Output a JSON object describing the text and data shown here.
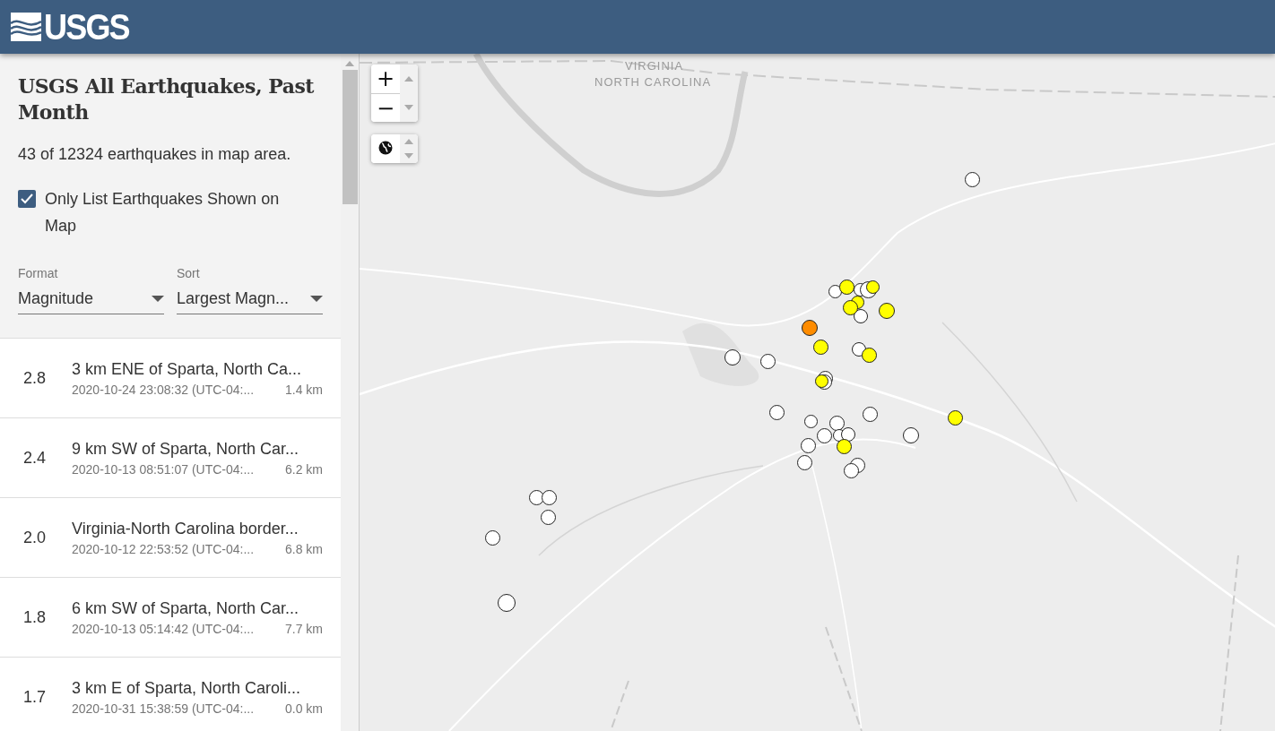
{
  "header": {
    "logo": "USGS"
  },
  "sidebar": {
    "title": "USGS All Earthquakes, Past Month",
    "count": "43 of 12324 earthquakes in map area.",
    "filter": {
      "label": "Only List Earthquakes Shown on Map",
      "checked": true
    },
    "selects": [
      {
        "label": "Format",
        "value": "Magnitude"
      },
      {
        "label": "Sort",
        "value": "Largest Magn..."
      }
    ],
    "events": [
      {
        "magnitude": "2.8",
        "place": "3 km ENE of Sparta, North Ca...",
        "time": "2020-10-24 23:08:32 (UTC-04:...",
        "depth": "1.4 km"
      },
      {
        "magnitude": "2.4",
        "place": "9 km SW of Sparta, North Car...",
        "time": "2020-10-13 08:51:07 (UTC-04:...",
        "depth": "6.2 km"
      },
      {
        "magnitude": "2.0",
        "place": "Virginia-North Carolina border...",
        "time": "2020-10-12 22:53:52 (UTC-04:...",
        "depth": "6.8 km"
      },
      {
        "magnitude": "1.8",
        "place": "6 km SW of Sparta, North Car...",
        "time": "2020-10-13 05:14:42 (UTC-04:...",
        "depth": "7.7 km"
      },
      {
        "magnitude": "1.7",
        "place": "3 km E of Sparta, North Caroli...",
        "time": "2020-10-31 15:38:59 (UTC-04:...",
        "depth": "0.0 km"
      }
    ]
  },
  "map": {
    "labels": [
      "VIRGINIA",
      "NORTH CAROLINA"
    ],
    "zoom_in": "+",
    "zoom_out": "−",
    "markers": [
      {
        "color": "#ffffff"
      },
      {
        "color": "#ffffff"
      },
      {
        "color": "#ffffff"
      },
      {
        "color": "#ffffff"
      },
      {
        "color": "#ffffff"
      },
      {
        "color": "#ffffff"
      },
      {
        "color": "#ffffff"
      },
      {
        "color": "#ffffff"
      },
      {
        "color": "#ffffff"
      },
      {
        "color": "#ffffff"
      },
      {
        "color": "#ffffff"
      },
      {
        "color": "#ffffff"
      },
      {
        "color": "#ffffff"
      },
      {
        "color": "#ffffff"
      },
      {
        "color": "#ffffff"
      },
      {
        "color": "#ffffff"
      },
      {
        "color": "#ffffff"
      },
      {
        "color": "#ffffff"
      },
      {
        "color": "#ffffff"
      },
      {
        "color": "#ffffff"
      },
      {
        "color": "#ffffff"
      },
      {
        "color": "#ffffff"
      },
      {
        "color": "#ffffff"
      },
      {
        "color": "#ffffff"
      },
      {
        "color": "#ffffff"
      },
      {
        "color": "#ffffff"
      },
      {
        "color": "#ffffff"
      },
      {
        "color": "#ffff00"
      },
      {
        "color": "#ffff00"
      },
      {
        "color": "#ffff00"
      },
      {
        "color": "#ffff00"
      },
      {
        "color": "#ffff00"
      },
      {
        "color": "#ffff00"
      },
      {
        "color": "#ffff00"
      },
      {
        "color": "#ffff00"
      },
      {
        "color": "#ffff00"
      },
      {
        "color": "#ffff00"
      },
      {
        "color": "#ff8c00"
      }
    ]
  }
}
